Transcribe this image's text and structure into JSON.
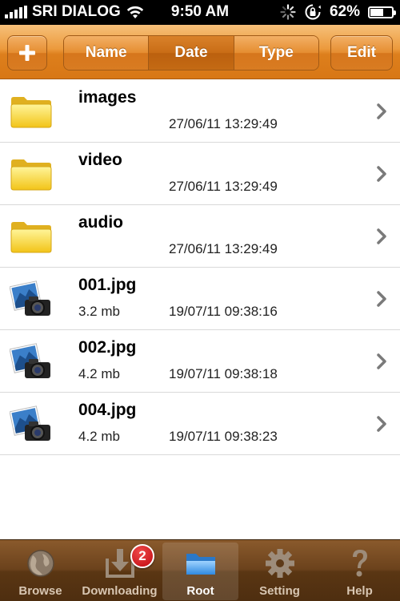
{
  "status_bar": {
    "carrier": "SRI DIALOG",
    "time": "9:50 AM",
    "battery": "62%",
    "battery_level": 0.62
  },
  "toolbar": {
    "add_label": "+",
    "sort_tabs": [
      {
        "label": "Name"
      },
      {
        "label": "Date",
        "active": true
      },
      {
        "label": "Type"
      }
    ],
    "edit_label": "Edit"
  },
  "files": [
    {
      "name": "images",
      "type": "folder",
      "size": "",
      "date": "27/06/11 13:29:49"
    },
    {
      "name": "video",
      "type": "folder",
      "size": "",
      "date": "27/06/11 13:29:49"
    },
    {
      "name": "audio",
      "type": "folder",
      "size": "",
      "date": "27/06/11 13:29:49"
    },
    {
      "name": "001.jpg",
      "type": "image",
      "size": "3.2 mb",
      "date": "19/07/11 09:38:16"
    },
    {
      "name": "002.jpg",
      "type": "image",
      "size": "4.2 mb",
      "date": "19/07/11 09:38:18"
    },
    {
      "name": "004.jpg",
      "type": "image",
      "size": "4.2 mb",
      "date": "19/07/11 09:38:23"
    }
  ],
  "tabbar": {
    "tabs": [
      {
        "label": "Browse",
        "icon": "globe-icon"
      },
      {
        "label": "Downloading",
        "icon": "download-icon",
        "badge": "2"
      },
      {
        "label": "Root",
        "icon": "folder-icon",
        "active": true
      },
      {
        "label": "Setting",
        "icon": "gear-icon"
      },
      {
        "label": "Help",
        "icon": "question-icon"
      }
    ]
  },
  "colors": {
    "toolbar_orange": "#e58d30",
    "tabbar_brown": "#6b421c",
    "badge_red": "#c0080f"
  }
}
